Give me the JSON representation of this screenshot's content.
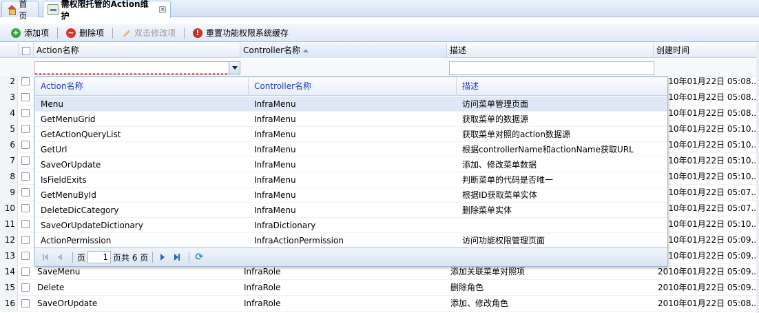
{
  "tabs": [
    {
      "label": "首页",
      "active": false
    },
    {
      "label": "需权限托管的Action维护",
      "active": true,
      "close": "×"
    }
  ],
  "toolbar": {
    "add": "添加项",
    "delete": "删除项",
    "edit": "双击修改项",
    "reset": "重置功能权限系统缓存"
  },
  "grid": {
    "columns": [
      "Action名称",
      "Controller名称",
      "描述",
      "创建时间"
    ],
    "sorted_column": "Controller名称",
    "rows": [
      {
        "num": "2",
        "action": "",
        "controller": "",
        "desc": "",
        "time": "2010年01月22日 05:08..."
      },
      {
        "num": "3",
        "action": "",
        "controller": "",
        "desc": "",
        "time": "2010年01月22日 05:08..."
      },
      {
        "num": "4",
        "action": "",
        "controller": "",
        "desc": "",
        "time": "2010年01月22日 05:08..."
      },
      {
        "num": "5",
        "action": "",
        "controller": "",
        "desc": "",
        "time": "2010年01月22日 05:10..."
      },
      {
        "num": "6",
        "action": "",
        "controller": "",
        "desc": "",
        "time": "2010年01月22日 05:10..."
      },
      {
        "num": "7",
        "action": "",
        "controller": "",
        "desc": "",
        "time": "2010年01月22日 05:10..."
      },
      {
        "num": "8",
        "action": "",
        "controller": "",
        "desc": "",
        "time": "2010年01月22日 05:10..."
      },
      {
        "num": "9",
        "action": "",
        "controller": "",
        "desc": "",
        "time": "2010年01月22日 05:07..."
      },
      {
        "num": "10",
        "action": "",
        "controller": "",
        "desc": "",
        "time": "2010年01月22日 05:07..."
      },
      {
        "num": "11",
        "action": "",
        "controller": "",
        "desc": "",
        "time": "2010年01月22日 05:10..."
      },
      {
        "num": "12",
        "action": "",
        "controller": "",
        "desc": "",
        "time": "2010年01月22日 05:09..."
      },
      {
        "num": "13",
        "action": "",
        "controller": "",
        "desc": "",
        "time": "2010年01月22日 05:09..."
      },
      {
        "num": "14",
        "action": "SaveMenu",
        "controller": "InfraRole",
        "desc": "添加关联菜单对照项",
        "time": "2010年01月22日 05:09..."
      },
      {
        "num": "15",
        "action": "Delete",
        "controller": "InfraRole",
        "desc": "删除角色",
        "time": "2010年01月22日 05:09..."
      },
      {
        "num": "16",
        "action": "SaveOrUpdate",
        "controller": "InfraRole",
        "desc": "添加、修改角色",
        "time": "2010年01月22日 05:08..."
      }
    ]
  },
  "popup": {
    "columns": [
      "Action名称",
      "Controller名称",
      "描述"
    ],
    "rows": [
      {
        "action": "Menu",
        "controller": "InfraMenu",
        "desc": "访问菜单管理页面",
        "selected": true
      },
      {
        "action": "GetMenuGrid",
        "controller": "InfraMenu",
        "desc": "获取菜单的数据源"
      },
      {
        "action": "GetActionQueryList",
        "controller": "InfraMenu",
        "desc": "获取菜单对照的action数据源"
      },
      {
        "action": "GetUrl",
        "controller": "InfraMenu",
        "desc": "根据controllerName和actionName获取URL"
      },
      {
        "action": "SaveOrUpdate",
        "controller": "InfraMenu",
        "desc": "添加、修改菜单数据"
      },
      {
        "action": "IsFieldExits",
        "controller": "InfraMenu",
        "desc": "判断菜单的代码是否唯一"
      },
      {
        "action": "GetMenuById",
        "controller": "InfraMenu",
        "desc": "根据ID获取菜单实体"
      },
      {
        "action": "DeleteDicCategory",
        "controller": "InfraMenu",
        "desc": "删除菜单实体"
      },
      {
        "action": "SaveOrUpdateDictionary",
        "controller": "InfraDictionary",
        "desc": ""
      },
      {
        "action": "ActionPermission",
        "controller": "InfraActionPermission",
        "desc": "访问功能权限管理页面"
      }
    ],
    "pager": {
      "page_label": "页",
      "page_value": "1",
      "total_label": "页共 6 页"
    }
  }
}
